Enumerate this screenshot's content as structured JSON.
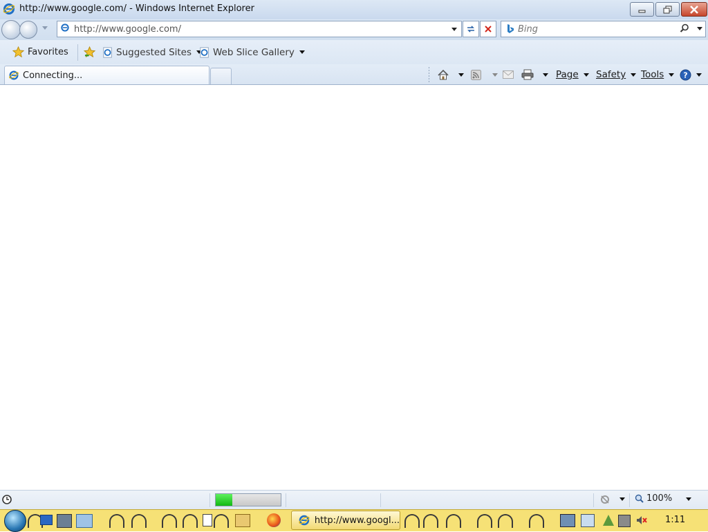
{
  "window": {
    "title": "http://www.google.com/ - Windows Internet Explorer"
  },
  "address_bar": {
    "url": "http://www.google.com/"
  },
  "search_box": {
    "placeholder": "Bing"
  },
  "favorites_bar": {
    "favorites_label": "Favorites",
    "links": [
      {
        "label": "Suggested Sites"
      },
      {
        "label": "Web Slice Gallery"
      }
    ]
  },
  "tab": {
    "title": "Connecting..."
  },
  "command_bar": {
    "page_label": "Page",
    "safety_label": "Safety",
    "tools_label": "Tools"
  },
  "status_bar": {
    "progress_fraction": 0.26,
    "zoom": "100%"
  },
  "taskbar": {
    "active_task_label": "http://www.googl...",
    "clock": "1:11"
  },
  "icons": {
    "ie": "ie-icon",
    "star": "star-icon",
    "home": "home-icon",
    "feeds": "rss-icon",
    "mail": "mail-icon",
    "print": "print-icon",
    "help": "help-icon",
    "search": "search-icon"
  },
  "colors": {
    "taskbar": "#f6e176",
    "progress": "#13b813",
    "ie_blue": "#1f6fc4"
  }
}
